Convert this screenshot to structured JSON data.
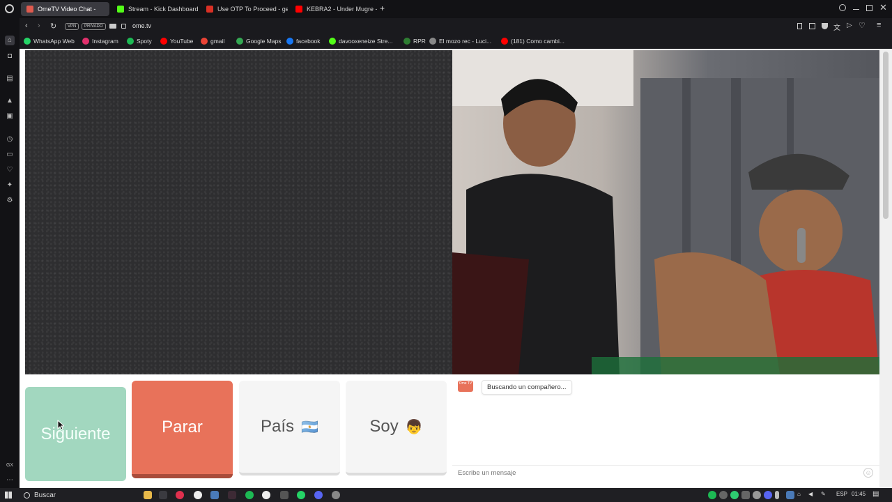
{
  "tabs": [
    {
      "label": "OmeTV Video Chat -",
      "color": "#e05a4e",
      "active": true
    },
    {
      "label": "Stream - Kick Dashboard",
      "color": "#53fc18",
      "active": false
    },
    {
      "label": "Use OTP To Proceed - ge",
      "color": "#d93025",
      "active": false
    },
    {
      "label": "KEBRA2 - Under Mugre -",
      "color": "#ff0000",
      "active": false
    }
  ],
  "new_tab": "+",
  "address": {
    "vpn": "VPN",
    "private": "PRIVADO",
    "url": "ome.tv"
  },
  "bookmarks": [
    {
      "label": "WhatsApp Web",
      "color": "#25d366"
    },
    {
      "label": "Instagram",
      "color": "#e1306c"
    },
    {
      "label": "Spoty",
      "color": "#1db954"
    },
    {
      "label": "YouTube",
      "color": "#ff0000"
    },
    {
      "label": "gmail",
      "color": "#ea4335"
    },
    {
      "label": "Google Maps",
      "color": "#34a853"
    },
    {
      "label": "facebook",
      "color": "#1877f2"
    },
    {
      "label": "davooxeneize Stre...",
      "color": "#53fc18"
    },
    {
      "label": "RPR",
      "color": "#2e7d32"
    },
    {
      "label": "El mozo rec - Luci...",
      "color": "#888888"
    },
    {
      "label": "(181) Como cambi...",
      "color": "#ff0000"
    }
  ],
  "controls": {
    "next": "Siguiente",
    "stop": "Parar",
    "country": "País",
    "country_flag": "🇦🇷",
    "gender": "Soy",
    "gender_icon": "👦"
  },
  "chat": {
    "logo": "Ome TV",
    "status": "Buscando un compañero...",
    "placeholder": "Escribe un mensaje"
  },
  "sidebar_gx": "GX",
  "taskbar": {
    "search": "Buscar",
    "lang": "ESP",
    "time": "01:45"
  }
}
